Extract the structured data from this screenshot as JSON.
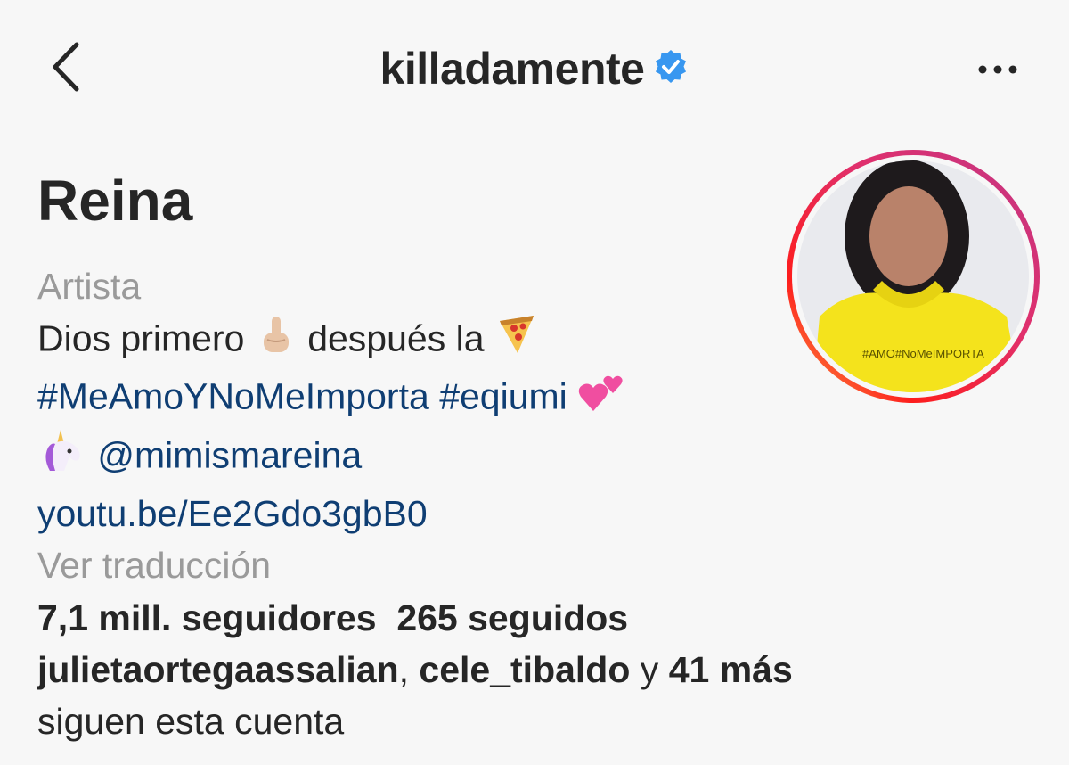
{
  "header": {
    "username": "killadamente",
    "back_icon": "chevron-left-icon",
    "verified_icon": "verified-badge-icon",
    "more_icon": "more-horizontal-icon"
  },
  "profile": {
    "display_name": "Reina",
    "avatar_text": "#AMO#NoMeIMPORTA",
    "category": "Artista",
    "bio_line1_a": "Dios primero",
    "bio_line1_b": "después la",
    "bio_hashtag1": "#MeAmoYNoMeImporta",
    "bio_hashtag2": "#eqiumi",
    "bio_mention": "@mimismareina",
    "bio_link": "youtu.be/Ee2Gdo3gbB0",
    "translate": "Ver traducción",
    "emojis": [
      "pointing-up-emoji",
      "pizza-emoji",
      "two-hearts-emoji",
      "unicorn-emoji"
    ]
  },
  "stats": {
    "followers": "7,1 mill. seguidores",
    "following": "265 seguidos",
    "followed_by_1": "julietaortegaassalian",
    "followed_by_sep": ", ",
    "followed_by_2": "cele_tibaldo",
    "followed_by_and": " y ",
    "followed_by_more": "41 más",
    "followed_by_suffix": "siguen esta cuenta"
  },
  "colors": {
    "link": "#0f3e73",
    "verified": "#3897f0",
    "muted": "#9a9a9a",
    "text": "#262626"
  }
}
